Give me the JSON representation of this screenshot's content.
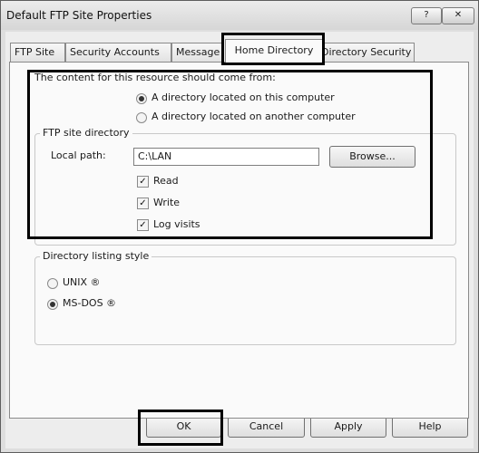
{
  "window": {
    "title": "Default FTP Site Properties",
    "help_label": "?",
    "close_label": "✕"
  },
  "tabs": [
    {
      "label": "FTP Site"
    },
    {
      "label": "Security Accounts"
    },
    {
      "label": "Message"
    },
    {
      "label": "Home Directory"
    },
    {
      "label": "Directory Security"
    }
  ],
  "home": {
    "content_source_label": "The content for this resource should come from:",
    "options": [
      {
        "label": "A directory located on this computer",
        "selected": true
      },
      {
        "label": "A directory located on another computer",
        "selected": false
      }
    ],
    "site_dir_legend": "FTP site directory",
    "local_path_label": "Local path:",
    "local_path_value": "C:\\LAN",
    "browse_label": "Browse...",
    "permissions": [
      {
        "label": "Read",
        "checked": true
      },
      {
        "label": "Write",
        "checked": true
      },
      {
        "label": "Log visits",
        "checked": true
      }
    ],
    "listing_legend": "Directory listing style",
    "listing_options": [
      {
        "label": "UNIX ®",
        "selected": false
      },
      {
        "label": "MS-DOS ®",
        "selected": true
      }
    ]
  },
  "footer": {
    "ok": "OK",
    "cancel": "Cancel",
    "apply": "Apply",
    "help": "Help"
  }
}
